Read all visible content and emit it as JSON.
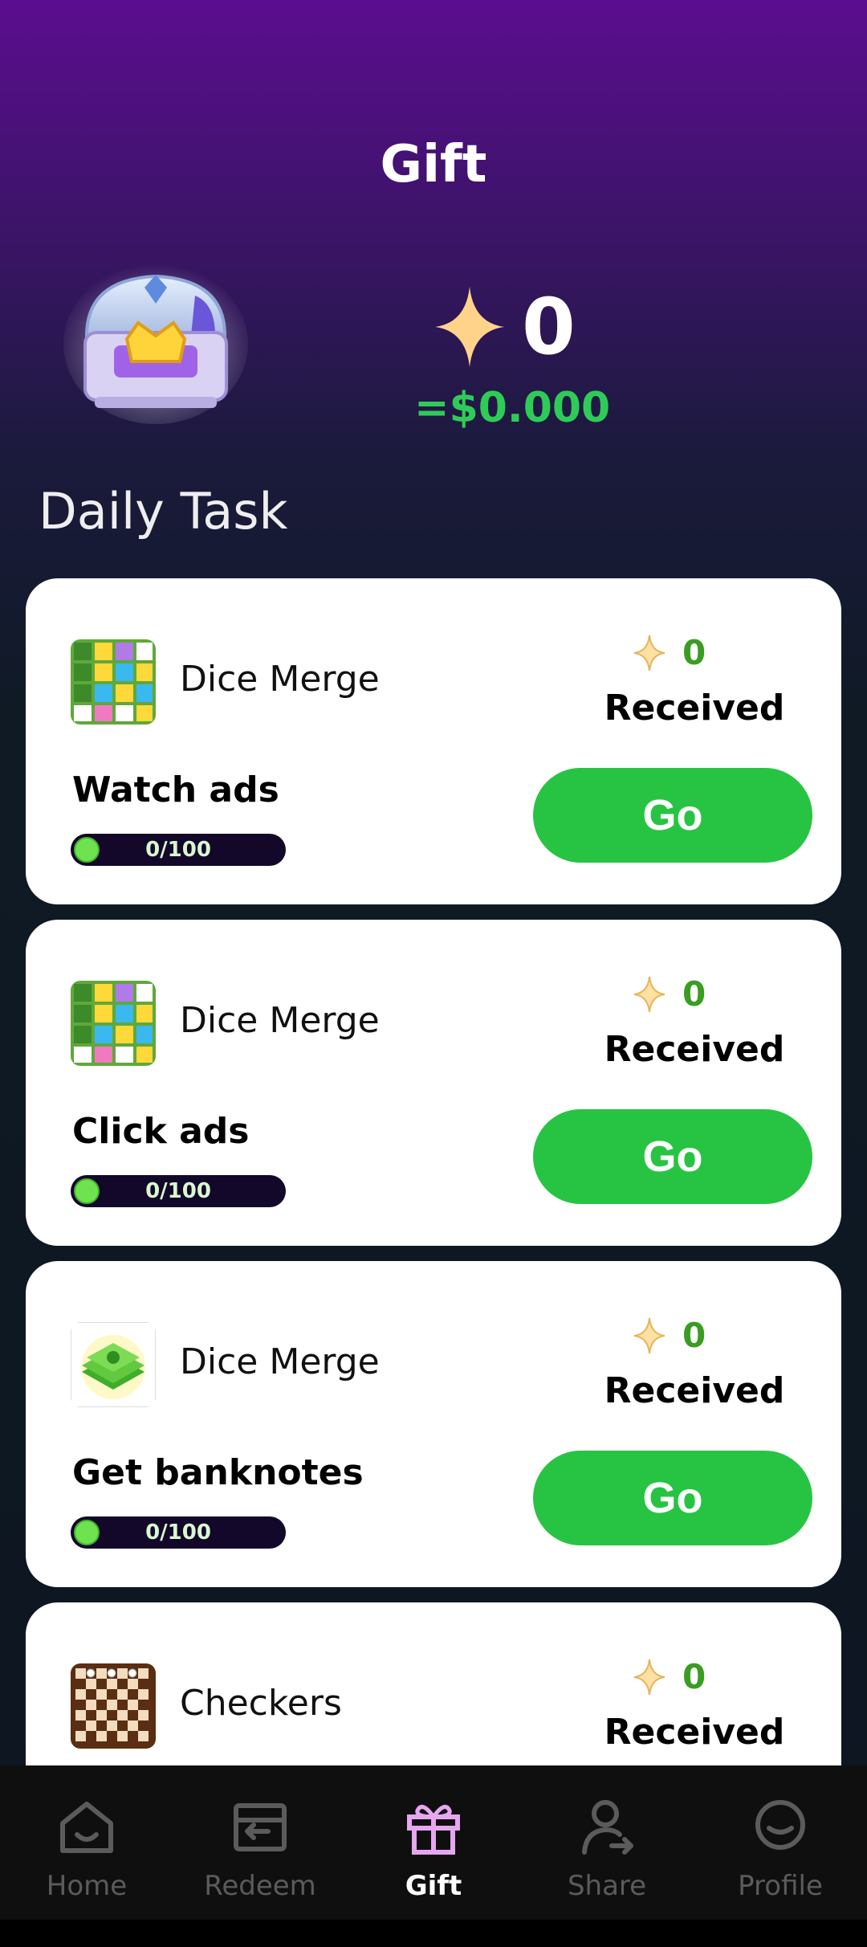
{
  "header": {
    "title": "Gift"
  },
  "balance": {
    "coins": "0",
    "usd": "=$0.000"
  },
  "section_title": "Daily Task",
  "tasks": [
    {
      "app_name": "Dice Merge",
      "icon": "dice-merge-icon",
      "reward": "0",
      "received_label": "Received",
      "task": "Watch ads",
      "progress": "0/100",
      "button": "Go"
    },
    {
      "app_name": "Dice Merge",
      "icon": "dice-merge-icon",
      "reward": "0",
      "received_label": "Received",
      "task": "Click ads",
      "progress": "0/100",
      "button": "Go"
    },
    {
      "app_name": "Dice Merge",
      "icon": "banknotes-icon",
      "reward": "0",
      "received_label": "Received",
      "task": "Get banknotes",
      "progress": "0/100",
      "button": "Go"
    },
    {
      "app_name": "Checkers",
      "icon": "checkers-icon",
      "reward": "0",
      "received_label": "Received"
    }
  ],
  "nav": [
    {
      "label": "Home",
      "icon": "home-icon"
    },
    {
      "label": "Redeem",
      "icon": "redeem-icon"
    },
    {
      "label": "Gift",
      "icon": "gift-icon",
      "active": true
    },
    {
      "label": "Share",
      "icon": "share-icon"
    },
    {
      "label": "Profile",
      "icon": "profile-icon"
    }
  ],
  "colors": {
    "accent_green": "#27c443",
    "usd_green": "#2ecc56",
    "reward_green": "#3a9d23",
    "active_nav_icon": "#e7a6f0"
  }
}
